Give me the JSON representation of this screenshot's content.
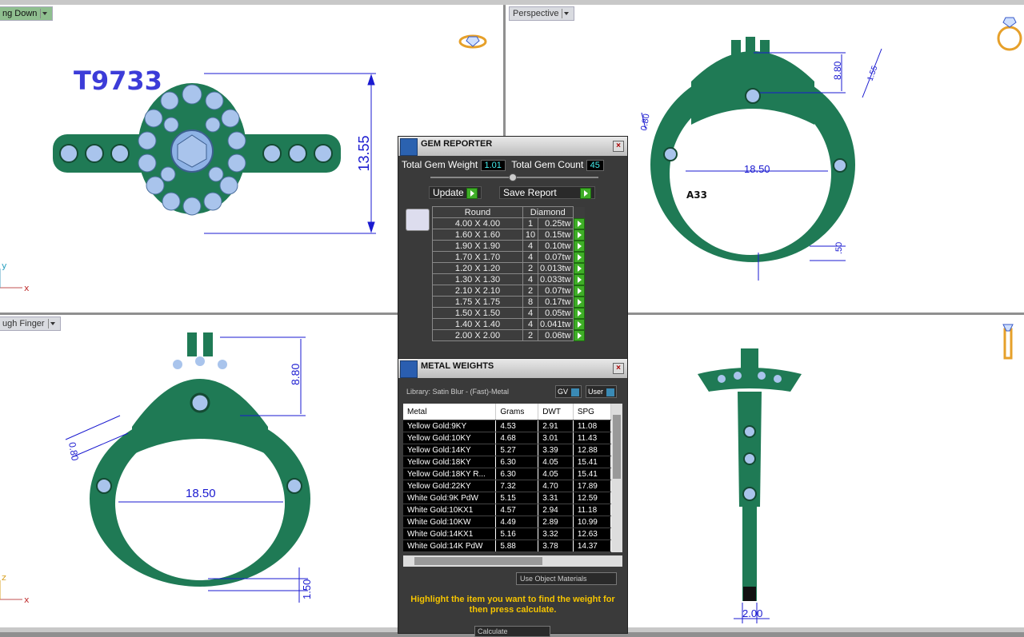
{
  "viewports": {
    "top_left": {
      "label": "ng Down",
      "ring_code": "T9733",
      "dim_height": "13.55",
      "axis_y": "y",
      "axis_x": "x"
    },
    "top_right": {
      "label": "Perspective",
      "dim_top_a": "8.80",
      "dim_top_b": "1.55",
      "dim_side": "0.80",
      "dim_inner": "18.50",
      "dim_bottom": ".50",
      "engraving": "A33"
    },
    "bottom_left": {
      "label": "ugh Finger",
      "dim_top": "8.80",
      "dim_side": "0.80",
      "dim_inner": "18.50",
      "dim_bottom": "1.50",
      "axis_z": "z",
      "axis_x": "x"
    },
    "bottom_right": {
      "dim_width": "2.00"
    }
  },
  "gem_reporter": {
    "title": "GEM REPORTER",
    "total_weight_label": "Total Gem Weight",
    "total_weight": "1.01",
    "total_count_label": "Total Gem Count",
    "total_count": "45",
    "update_label": "Update",
    "save_label": "Save Report",
    "shape": "Round",
    "material": "Diamond",
    "rows": [
      {
        "size": "4.00 X 4.00",
        "count": "1",
        "weight": "0.25tw"
      },
      {
        "size": "1.60 X 1.60",
        "count": "10",
        "weight": "0.15tw"
      },
      {
        "size": "1.90 X 1.90",
        "count": "4",
        "weight": "0.10tw"
      },
      {
        "size": "1.70 X 1.70",
        "count": "4",
        "weight": "0.07tw"
      },
      {
        "size": "1.20 X 1.20",
        "count": "2",
        "weight": "0.013tw"
      },
      {
        "size": "1.30 X 1.30",
        "count": "4",
        "weight": "0.033tw"
      },
      {
        "size": "2.10 X 2.10",
        "count": "2",
        "weight": "0.07tw"
      },
      {
        "size": "1.75 X 1.75",
        "count": "8",
        "weight": "0.17tw"
      },
      {
        "size": "1.50 X 1.50",
        "count": "4",
        "weight": "0.05tw"
      },
      {
        "size": "1.40 X 1.40",
        "count": "4",
        "weight": "0.041tw"
      },
      {
        "size": "2.00 X 2.00",
        "count": "2",
        "weight": "0.06tw"
      }
    ]
  },
  "metal_weights": {
    "title": "METAL WEIGHTS",
    "library": "Library: Satin Blur - (Fast)-Metal",
    "gv_label": "GV",
    "user_label": "User",
    "columns": [
      "Metal",
      "Grams",
      "DWT",
      "SPG"
    ],
    "rows": [
      {
        "metal": "Yellow Gold:9KY",
        "grams": "4.53",
        "dwt": "2.91",
        "spg": "11.08"
      },
      {
        "metal": "Yellow Gold:10KY",
        "grams": "4.68",
        "dwt": "3.01",
        "spg": "11.43"
      },
      {
        "metal": "Yellow Gold:14KY",
        "grams": "5.27",
        "dwt": "3.39",
        "spg": "12.88"
      },
      {
        "metal": "Yellow Gold:18KY",
        "grams": "6.30",
        "dwt": "4.05",
        "spg": "15.41"
      },
      {
        "metal": "Yellow Gold:18KY R...",
        "grams": "6.30",
        "dwt": "4.05",
        "spg": "15.41"
      },
      {
        "metal": "Yellow Gold:22KY",
        "grams": "7.32",
        "dwt": "4.70",
        "spg": "17.89"
      },
      {
        "metal": "White Gold:9K PdW",
        "grams": "5.15",
        "dwt": "3.31",
        "spg": "12.59"
      },
      {
        "metal": "White Gold:10KX1",
        "grams": "4.57",
        "dwt": "2.94",
        "spg": "11.18"
      },
      {
        "metal": "White Gold:10KW",
        "grams": "4.49",
        "dwt": "2.89",
        "spg": "10.99"
      },
      {
        "metal": "White Gold:14KX1",
        "grams": "5.16",
        "dwt": "3.32",
        "spg": "12.63"
      },
      {
        "metal": "White Gold:14K PdW",
        "grams": "5.88",
        "dwt": "3.78",
        "spg": "14.37"
      }
    ],
    "use_object_materials": "Use Object Materials",
    "hint": "Highlight the item you want to find the weight for then press calculate.",
    "calculate_label": "Calculate"
  },
  "colors": {
    "ring": "#1f7a55",
    "gem": "#a9c4ec",
    "dim": "#1a1ad0"
  }
}
